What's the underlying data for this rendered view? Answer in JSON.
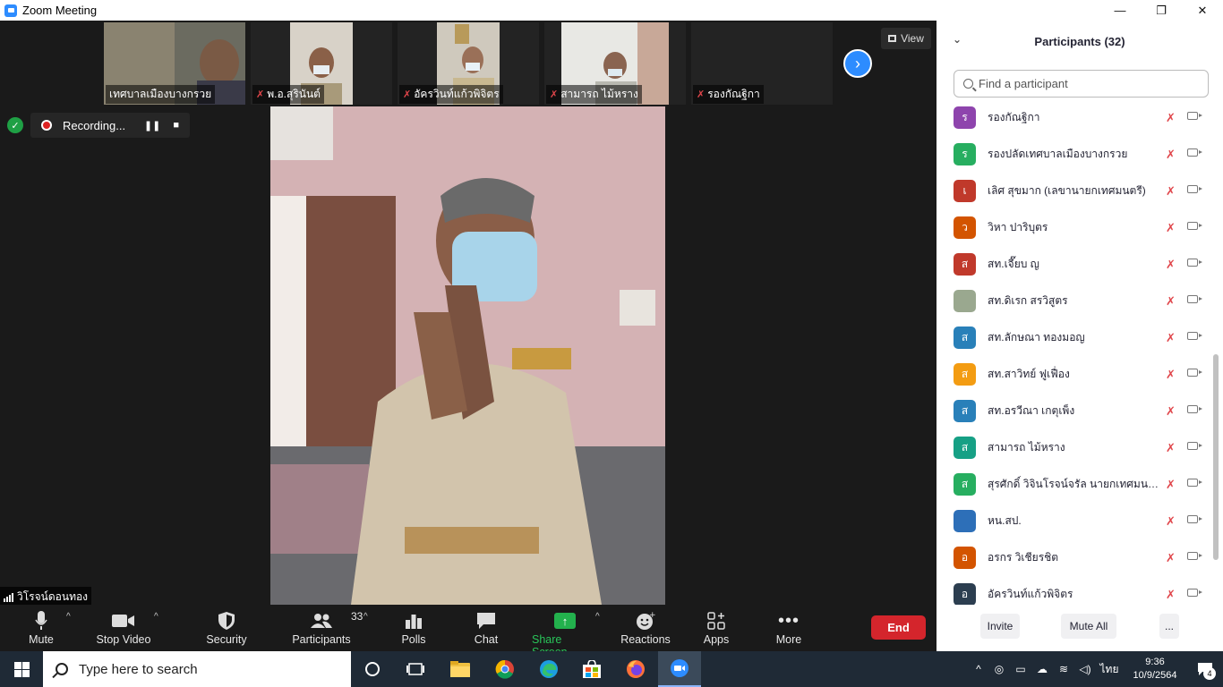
{
  "window": {
    "title": "Zoom Meeting",
    "minimize": "—",
    "maximize": "❐",
    "close": "✕"
  },
  "thumbnails": [
    {
      "name": "เทศบาลเมืองบางกรวย",
      "muted": false
    },
    {
      "name": "พ.อ.สุรินันต์",
      "muted": true
    },
    {
      "name": "อัครวินท์แก้วพิจิตร",
      "muted": true
    },
    {
      "name": "สามารถ ไม้หราง",
      "muted": true
    },
    {
      "name": "รองกัณฐิกา",
      "muted": true
    }
  ],
  "view_button": "View",
  "recording": {
    "label": "Recording..."
  },
  "active_speaker": "วิโรจน์ดอนทอง",
  "toolbar": {
    "mute": "Mute",
    "stop_video": "Stop Video",
    "security": "Security",
    "participants": "Participants",
    "participants_count": "33",
    "polls": "Polls",
    "chat": "Chat",
    "share_screen": "Share Screen",
    "reactions": "Reactions",
    "apps": "Apps",
    "more": "More",
    "end": "End"
  },
  "panel": {
    "title": "Participants (32)",
    "search_placeholder": "Find a participant",
    "participants": [
      {
        "initial": "ร",
        "name": "รองกัณฐิกา",
        "color": "#8e44ad"
      },
      {
        "initial": "ร",
        "name": "รองปลัดเทศบาลเมืองบางกรวย",
        "color": "#27ae60"
      },
      {
        "initial": "เ",
        "name": "เลิศ สุขมาก (เลขานายกเทศมนตรี)",
        "color": "#c0392b"
      },
      {
        "initial": "ว",
        "name": "วิหา ปาริบุตร",
        "color": "#d35400"
      },
      {
        "initial": "ส",
        "name": "สท.เจี๊ยบ ญ",
        "color": "#c0392b"
      },
      {
        "initial": "",
        "name": "สท.ดิเรก สรวิสูตร",
        "color": "#9aa88f"
      },
      {
        "initial": "ส",
        "name": "สท.ลักษณา ทองมอญ",
        "color": "#2980b9"
      },
      {
        "initial": "ส",
        "name": "สท.สาวิทย์ ฟูเฟื่อง",
        "color": "#f39c12"
      },
      {
        "initial": "ส",
        "name": "สท.อรวีณา เกตุเพ็ง",
        "color": "#2980b9"
      },
      {
        "initial": "ส",
        "name": "สามารถ ไม้หราง",
        "color": "#16a085"
      },
      {
        "initial": "ส",
        "name": "สุรศักดิ์ วิจินโรจน์จรัล นายกเทศมนตรี...",
        "color": "#27ae60"
      },
      {
        "initial": "",
        "name": "หน.สป.",
        "color": "#2d6fb8"
      },
      {
        "initial": "อ",
        "name": "อรกร วิเชียรชิต",
        "color": "#d35400"
      },
      {
        "initial": "อ",
        "name": "อัครวินท์แก้วพิจิตร",
        "color": "#2c3e50"
      }
    ],
    "invite": "Invite",
    "mute_all": "Mute All",
    "more": "..."
  },
  "taskbar": {
    "search_placeholder": "Type here to search",
    "time": "9:36",
    "date": "10/9/2564",
    "language": "ไทย",
    "notifications": "4"
  }
}
